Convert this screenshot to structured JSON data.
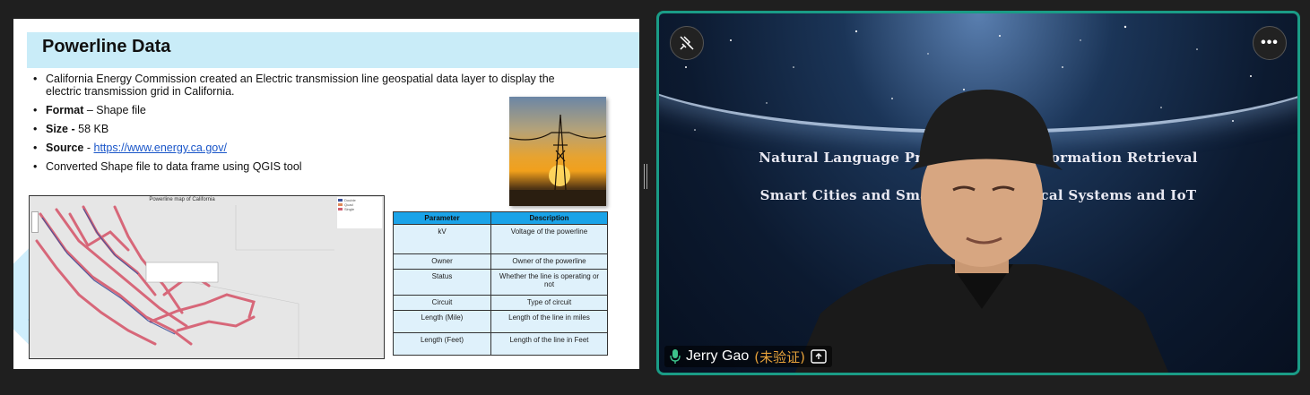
{
  "slide": {
    "title": "Powerline Data",
    "bullets": {
      "b1": "California Energy Commission created an Electric transmission line geospatial data layer to display the electric transmission grid in California.",
      "b2_label": "Format",
      "b2_value": " – Shape file",
      "b3_label": "Size - ",
      "b3_value": "58 KB",
      "b4_label": "Source",
      "b4_sep": " - ",
      "b4_link": "https://www.energy.ca.gov/",
      "b5": "Converted Shape file to data frame using QGIS tool"
    },
    "map": {
      "title": "Powerline map of California",
      "legend": [
        "Double",
        "Quad",
        "Single"
      ],
      "legend_colors": [
        "#3a4f9a",
        "#e08a5a",
        "#d06070"
      ]
    },
    "table": {
      "headers": [
        "Parameter",
        "Description"
      ],
      "rows": [
        {
          "param": "kV",
          "desc": "Voltage of the powerline"
        },
        {
          "param": "Owner",
          "desc": "Owner of the powerline"
        },
        {
          "param": "Status",
          "desc": "Whether the line is operating or not"
        },
        {
          "param": "Circuit",
          "desc": "Type of circuit"
        },
        {
          "param": "Length (Mile)",
          "desc": "Length of the line in miles"
        },
        {
          "param": "Length (Feet)",
          "desc": "Length of the line in Feet"
        }
      ]
    }
  },
  "video": {
    "line1": "Natural Language Processing and Information Retrieval",
    "line2": "Smart Cities and Smart Cyber-Physical Systems and IoT",
    "participant_name": "Jerry Gao",
    "unverified_label": "(未验证)",
    "more_label": "•••",
    "icons": {
      "pin": "unpin-icon",
      "more": "more-options-icon",
      "mic": "microphone-icon",
      "share": "share-screen-icon"
    }
  },
  "colors": {
    "header_band": "#c9ecf8",
    "table_header": "#1aa3e8",
    "tile_border": "#1a9c86",
    "unverified": "#e7a23a"
  }
}
